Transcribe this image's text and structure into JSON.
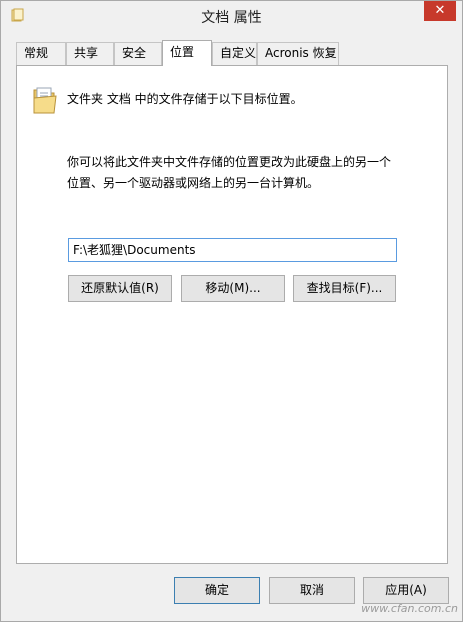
{
  "window": {
    "title": "文档 属性",
    "close_glyph": "✕"
  },
  "tabs": [
    {
      "label": "常规"
    },
    {
      "label": "共享"
    },
    {
      "label": "安全"
    },
    {
      "label": "位置",
      "active": true
    },
    {
      "label": "自定义"
    },
    {
      "label": "Acronis 恢复"
    }
  ],
  "location": {
    "description": "文件夹 文档 中的文件存储于以下目标位置。",
    "info_line1": "你可以将此文件夹中文件存储的位置更改为此硬盘上的另一个",
    "info_line2": "位置、另一个驱动器或网络上的另一台计算机。",
    "path_value": "F:\\老狐狸\\Documents",
    "restore_default_label": "还原默认值(R)",
    "move_label": "移动(M)...",
    "find_target_label": "查找目标(F)..."
  },
  "footer": {
    "ok_label": "确定",
    "cancel_label": "取消",
    "apply_label": "应用(A)"
  },
  "watermark": "www.cfan.com.cn"
}
